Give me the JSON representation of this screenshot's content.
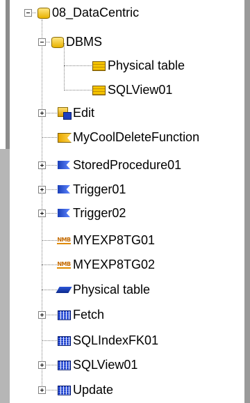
{
  "tree": {
    "nodes": [
      {
        "label": "08_DataCentric",
        "icon": "folder-database-icon"
      },
      {
        "label": "DBMS",
        "icon": "folder-database-icon"
      },
      {
        "label": "Physical table",
        "icon": "physical-table-icon"
      },
      {
        "label": "SQLView01",
        "icon": "sql-view-icon"
      },
      {
        "label": "Edit",
        "icon": "edit-component-icon"
      },
      {
        "label": "MyCoolDeleteFunction",
        "icon": "function-icon"
      },
      {
        "label": "StoredProcedure01",
        "icon": "stored-procedure-icon"
      },
      {
        "label": "Trigger01",
        "icon": "trigger-icon"
      },
      {
        "label": "Trigger02",
        "icon": "trigger-icon"
      },
      {
        "label": "MYEXP8TG01",
        "icon": "numbering-icon"
      },
      {
        "label": "MYEXP8TG02",
        "icon": "numbering-icon"
      },
      {
        "label": "Physical table",
        "icon": "table-entity-icon"
      },
      {
        "label": "Fetch",
        "icon": "grid-icon"
      },
      {
        "label": "SQLIndexFK01",
        "icon": "grid-icon"
      },
      {
        "label": "SQLView01",
        "icon": "grid-icon"
      },
      {
        "label": "Update",
        "icon": "grid-icon"
      }
    ],
    "nmb_icon_text": "NMB"
  }
}
